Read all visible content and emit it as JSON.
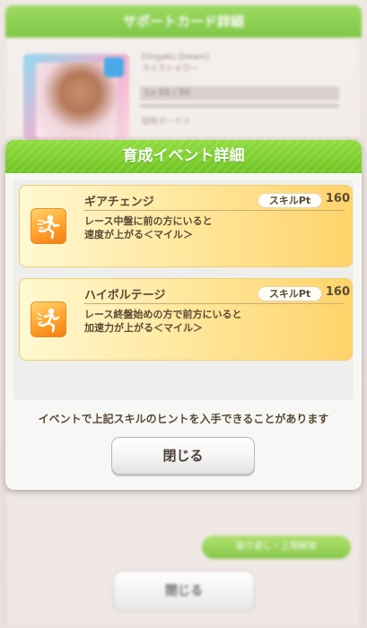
{
  "background": {
    "header_title": "サポートカード詳細",
    "card_name_line1": "[Ongaku Dream]",
    "card_name_line2": "ライスシャワー",
    "level_text": "Lv 50 / 50",
    "effect_label": "固有ボーナス",
    "green_button": "振り返し・上限解放",
    "close_label": "閉じる"
  },
  "dialog": {
    "title": "育成イベント詳細",
    "skills": [
      {
        "name": "ギアチェンジ",
        "pt_label": "スキルPt",
        "pt_value": "160",
        "desc_line1": "レース中盤に前の方にいると",
        "desc_line2": "速度が上がる＜マイル＞",
        "icon": "speed-runner-icon"
      },
      {
        "name": "ハイボルテージ",
        "pt_label": "スキルPt",
        "pt_value": "160",
        "desc_line1": "レース終盤始めの方で前方にいると",
        "desc_line2": "加速力が上がる＜マイル＞",
        "icon": "acceleration-runner-icon"
      }
    ],
    "hint": "イベントで上記スキルのヒントを入手できることがあります",
    "close_label": "閉じる"
  },
  "colors": {
    "header_green": "#76c829",
    "card_gold": "#ffd36a",
    "text_brown": "#5b4a36"
  }
}
